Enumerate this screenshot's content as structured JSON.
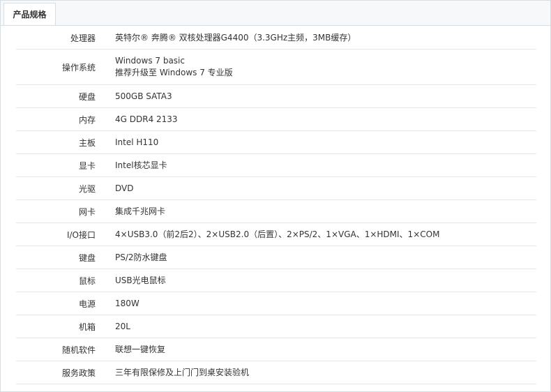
{
  "tab": {
    "label": "产品规格"
  },
  "specs": [
    {
      "key": "处理器",
      "value": "英特尔® 奔腾® 双核处理器G4400（3.3GHz主频，3MB缓存）"
    },
    {
      "key": "操作系统",
      "value": "Windows 7 basic",
      "value2": "推荐升级至 Windows 7 专业版"
    },
    {
      "key": "硬盘",
      "value": "500GB SATA3"
    },
    {
      "key": "内存",
      "value": "4G DDR4 2133"
    },
    {
      "key": "主板",
      "value": "Intel H110"
    },
    {
      "key": "显卡",
      "value": "Intel核芯显卡"
    },
    {
      "key": "光驱",
      "value": "DVD"
    },
    {
      "key": "网卡",
      "value": "集成千兆网卡"
    },
    {
      "key": "I/O接口",
      "value": "4×USB3.0（前2后2）、2×USB2.0（后置）、2×PS/2、1×VGA、1×HDMI、1×COM"
    },
    {
      "key": "键盘",
      "value": "PS/2防水键盘"
    },
    {
      "key": "鼠标",
      "value": "USB光电鼠标"
    },
    {
      "key": "电源",
      "value": "180W"
    },
    {
      "key": "机箱",
      "value": "20L"
    },
    {
      "key": "随机软件",
      "value": "联想一键恢复"
    },
    {
      "key": "服务政策",
      "value": "三年有限保修及上门门到桌安装验机"
    }
  ]
}
